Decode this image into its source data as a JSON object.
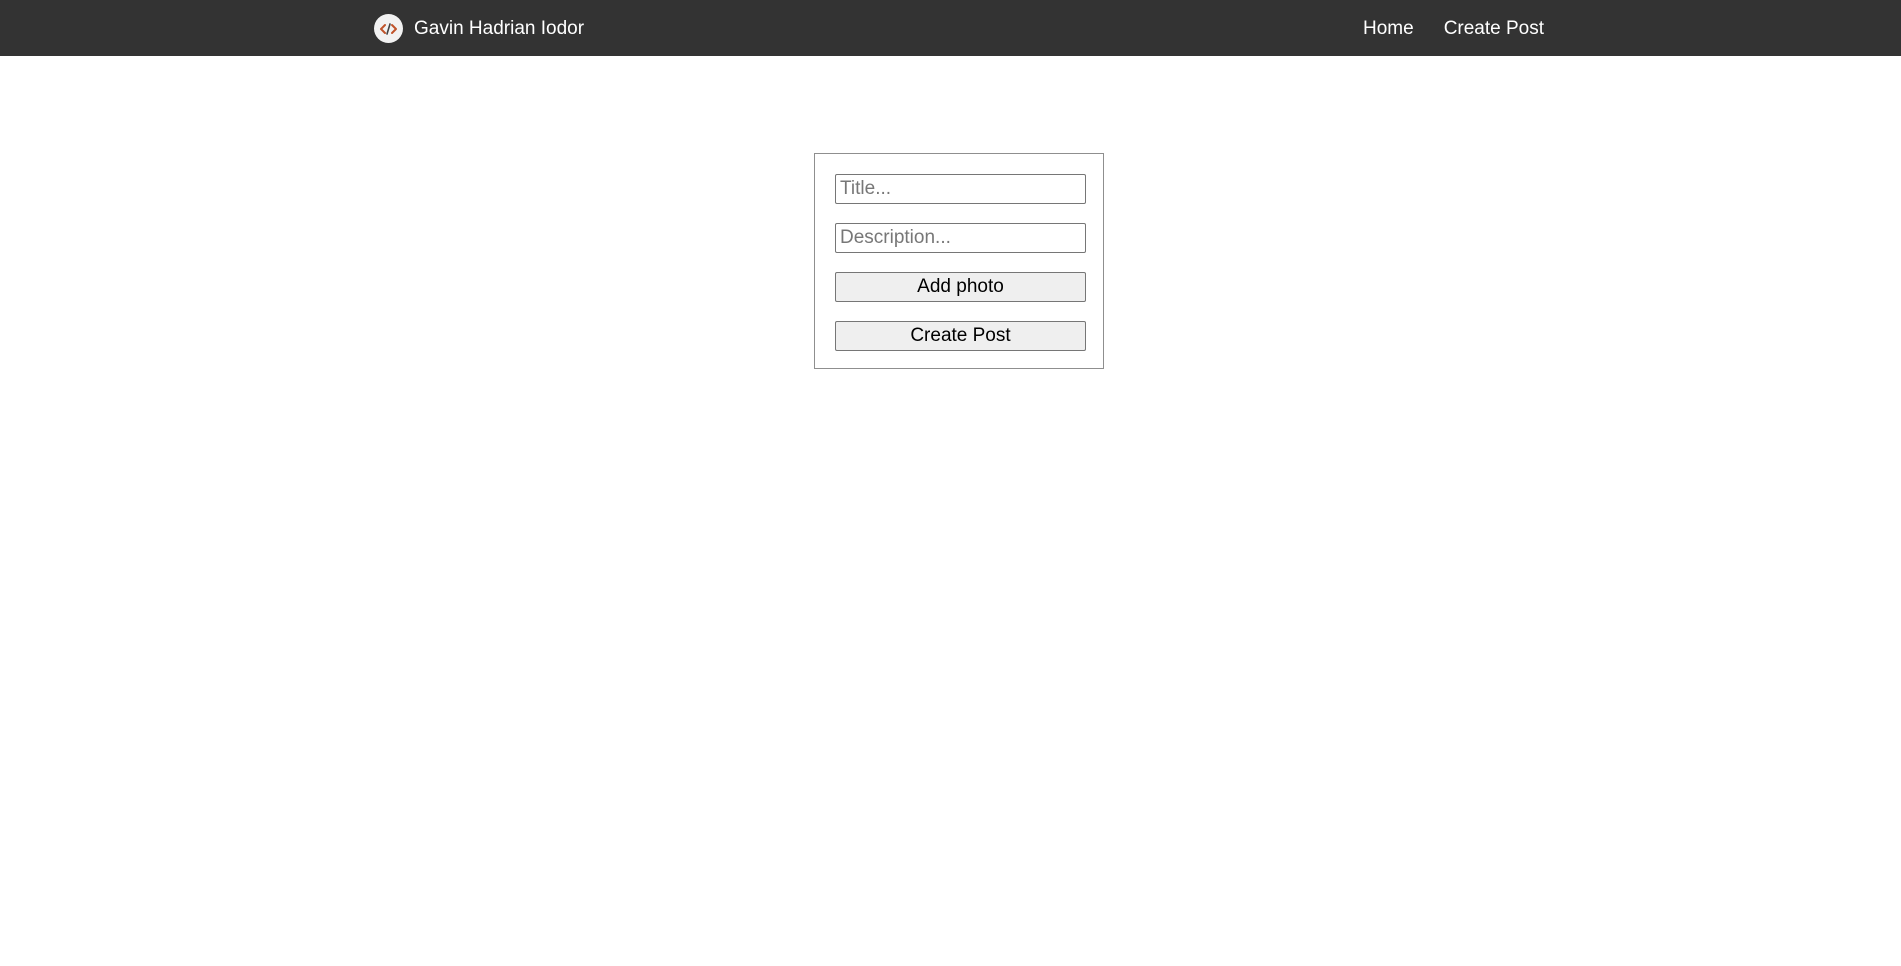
{
  "navbar": {
    "brand_icon": "code-icon",
    "brand_name": "Gavin Hadrian Iodor",
    "links": [
      {
        "label": "Home"
      },
      {
        "label": "Create Post"
      }
    ],
    "colors": {
      "background": "#333333",
      "text": "#ffffff",
      "logo_accent": "#c0532a"
    }
  },
  "form": {
    "title": {
      "value": "",
      "placeholder": "Title..."
    },
    "description": {
      "value": "",
      "placeholder": "Description..."
    },
    "add_photo_label": "Add photo",
    "create_post_label": "Create Post"
  }
}
